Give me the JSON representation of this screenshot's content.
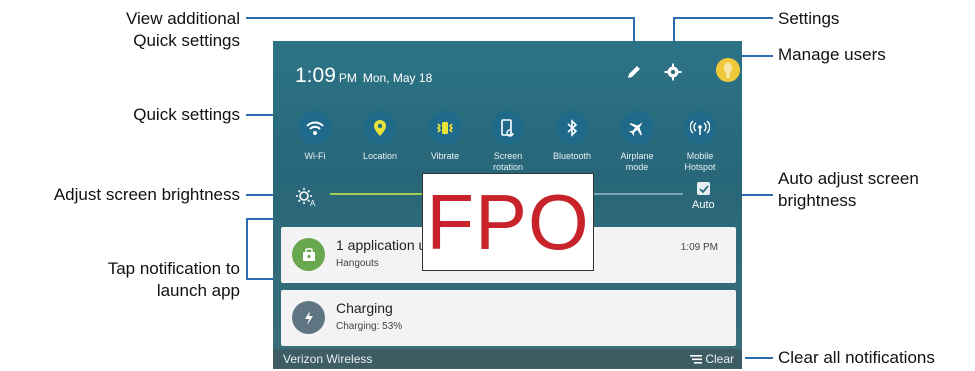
{
  "callouts": {
    "view_additional": "View additional",
    "quick_settings_line2": "Quick settings",
    "settings": "Settings",
    "manage_users": "Manage users",
    "quick_settings": "Quick settings",
    "adjust_brightness": "Adjust screen brightness",
    "auto_adjust_line1": "Auto adjust screen",
    "auto_adjust_line2": "brightness",
    "tap_notification_line1": "Tap notification to",
    "tap_notification_line2": "launch app",
    "clear_all": "Clear all notifications"
  },
  "status": {
    "time": "1:09",
    "ampm": "PM",
    "date": "Mon, May 18"
  },
  "top_icons": [
    "pencil-icon",
    "gear-icon",
    "user-avatar-icon"
  ],
  "quick_settings": [
    {
      "label": "Wi-Fi",
      "icon": "wifi-icon"
    },
    {
      "label": "Location",
      "icon": "location-icon"
    },
    {
      "label": "Vibrate",
      "icon": "vibrate-icon"
    },
    {
      "label": "Screen rotation",
      "icon": "screen-rotation-icon"
    },
    {
      "label": "Bluetooth",
      "icon": "bluetooth-icon"
    },
    {
      "label": "Airplane mode",
      "icon": "airplane-icon"
    },
    {
      "label": "Mobile Hotspot",
      "icon": "hotspot-icon"
    }
  ],
  "brightness": {
    "auto_label": "Auto",
    "auto_checked": true
  },
  "fpo": "FPO",
  "notifications": [
    {
      "title": "1 application u",
      "subtitle": "Hangouts",
      "time": "1:09 PM",
      "color": "#6aa84f",
      "icon": "hangouts-icon"
    },
    {
      "title": "Charging",
      "subtitle": "Charging: 53%",
      "time": "",
      "color": "#5f7682",
      "icon": "charging-icon"
    }
  ],
  "bottom_bar": {
    "carrier": "Verizon Wireless",
    "clear_label": "Clear"
  },
  "colors": {
    "accent_line": "#2a6db0",
    "panel": "#2c6f7e",
    "qs_circle": "#1f6a8a",
    "fpo_text": "#c8222a"
  }
}
